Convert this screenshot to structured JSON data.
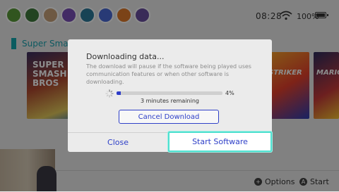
{
  "status": {
    "time": "08:28",
    "battery_text": "100%"
  },
  "users": {
    "avatar_colors": [
      "#5a9c3a",
      "#3f7a3c",
      "#c9a27a",
      "#7a4fb8",
      "#2d7a9c",
      "#4a6ad8",
      "#e07a2a",
      "#6a4fa0"
    ]
  },
  "game": {
    "title": "Super Smash Bros. Ultimate",
    "card_main_text": "SUPER SMASH BROS",
    "card_right1_text": "STRIKER",
    "card_right2_text": "MARIO"
  },
  "dialog": {
    "title": "Downloading data...",
    "description": "The download will pause if the software being played uses communication features or when other software is downloading.",
    "progress": 0.04,
    "progress_label": "4%",
    "remaining": "3 minutes remaining",
    "cancel_label": "Cancel Download",
    "close_label": "Close",
    "start_label": "Start Software"
  },
  "footer": {
    "options_label": "Options",
    "options_button": "+",
    "start_label": "Start",
    "start_button": "A"
  },
  "colors": {
    "accent_blue": "#2f40c8",
    "focus_teal": "#4fe0cf",
    "title_teal": "#1aa3b0"
  }
}
